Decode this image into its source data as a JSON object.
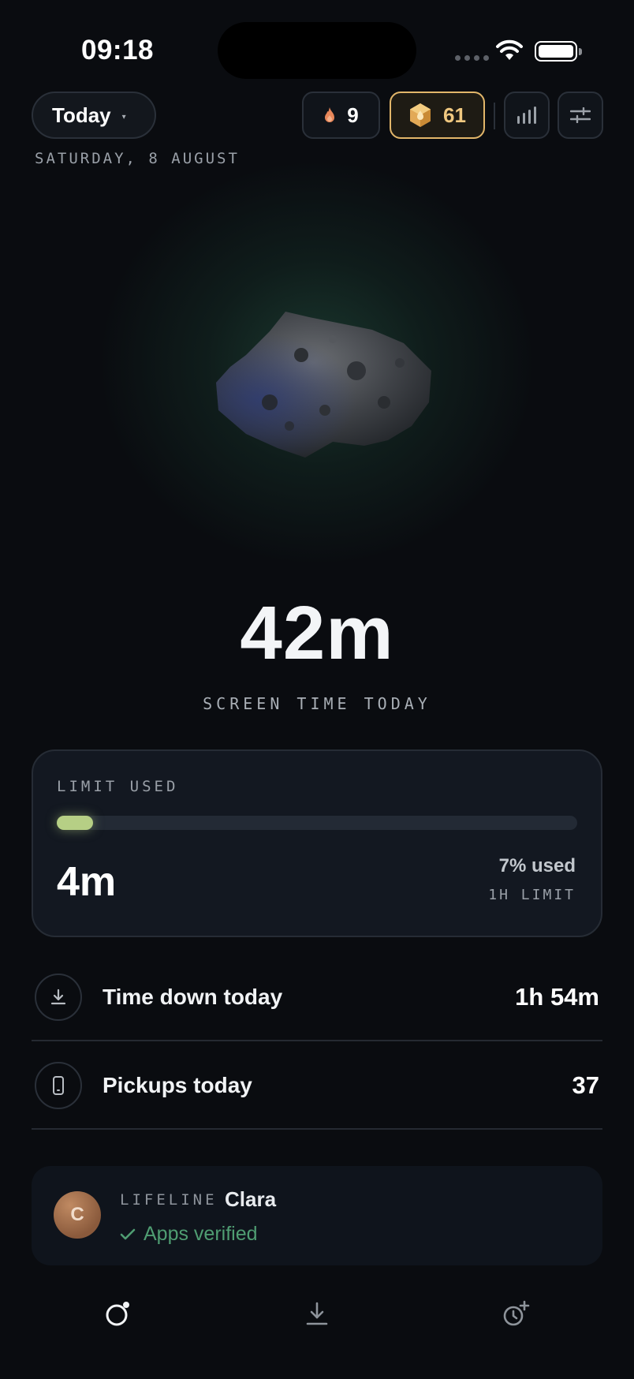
{
  "status_bar": {
    "time": "09:18"
  },
  "header": {
    "period_selector": {
      "label": "Today",
      "caret": "▾"
    },
    "streak": {
      "icon": "flame-icon",
      "value": "9",
      "color": "#e8875a"
    },
    "coins": {
      "icon": "hexagon-coin-icon",
      "value": "61",
      "color": "#e2b66a"
    },
    "stats_button": {
      "icon": "bar-chart-icon"
    },
    "settings_button": {
      "icon": "sliders-icon"
    },
    "date": "SATURDAY, 8 AUGUST"
  },
  "hero": {
    "image": "asteroid-rock",
    "screen_time_value": "42m",
    "screen_time_caption": "SCREEN TIME TODAY"
  },
  "limit_card": {
    "label": "LIMIT USED",
    "progress_fraction": 0.07,
    "used_value": "4m",
    "percent_used": "7% used",
    "limit": "1H LIMIT",
    "accent": "#b6cf85"
  },
  "stats": [
    {
      "icon": "download-icon",
      "label": "Time down today",
      "value": "1h 54m"
    },
    {
      "icon": "phone-icon",
      "label": "Pickups today",
      "value": "37"
    }
  ],
  "lifeline": {
    "tag": "LIFELINE",
    "name": "Clara",
    "avatar_initial": "C",
    "status": "Apps verified",
    "status_color": "#4f9d72"
  },
  "bottom_nav": [
    {
      "icon": "orbit-icon",
      "active": true
    },
    {
      "icon": "download-icon",
      "active": false
    },
    {
      "icon": "alarm-add-icon",
      "active": false
    }
  ]
}
